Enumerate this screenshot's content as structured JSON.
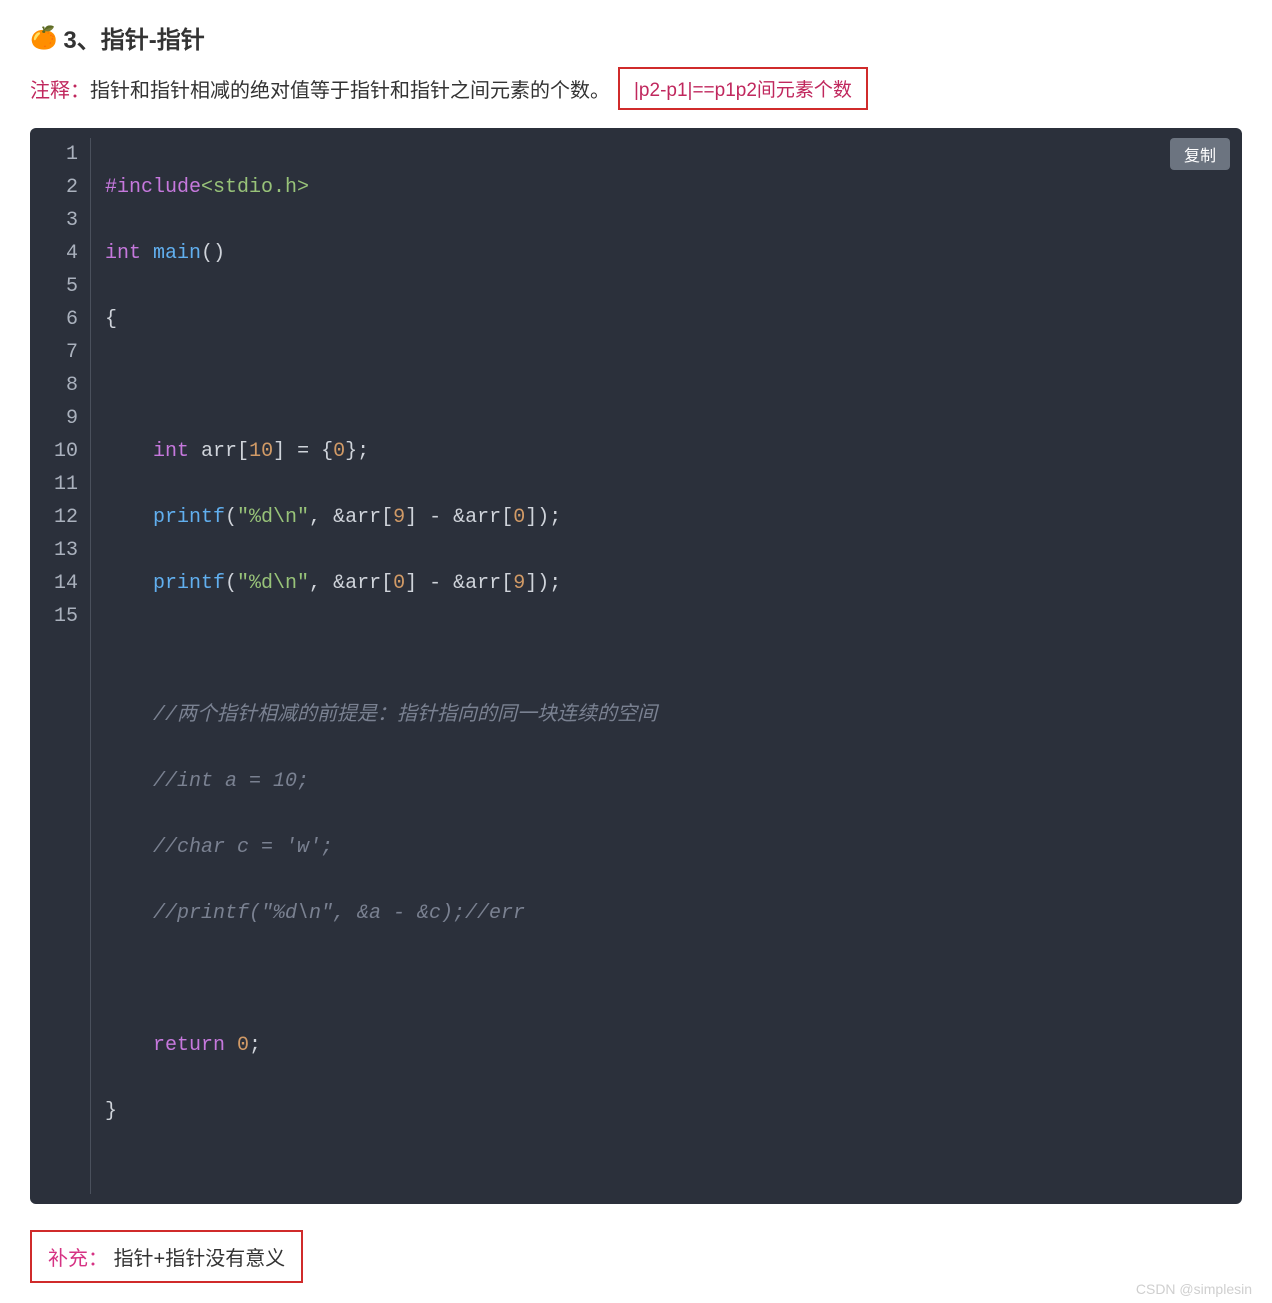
{
  "heading": {
    "emoji": "🍊",
    "text": "3、指针-指针"
  },
  "note": {
    "label": "注释：",
    "text": "指针和指针相减的绝对值等于指针和指针之间元素的个数。",
    "formula": "|p2-p1|==p1p2间元素个数"
  },
  "code": {
    "copy_label": "复制",
    "line_count": 15,
    "include_kw": "#include",
    "include_hdr": "<stdio.h>",
    "int_kw": "int",
    "main_fn": "main",
    "lparen": "(",
    "rparen": ")",
    "lbrace": "{",
    "rbrace": "}",
    "arr_ident": "arr",
    "lbrack": "[",
    "rbrack": "]",
    "ten": "10",
    "nine": "9",
    "zero": "0",
    "zeroA": "0",
    "zeroB": "0",
    "eq": " = ",
    "init": "{0}",
    "semi": ";",
    "printf_fn": "printf",
    "fmt": "\"%d\\n\"",
    "comma_sp": ", ",
    "amp": "&",
    "space_minus": " - ",
    "return_kw": "return",
    "cmt1": "//两个指针相减的前提是：指针指向的同一块连续的空间",
    "cmt2": "//int a = 10;",
    "cmt3": "//char c = 'w';",
    "cmt4": "//printf(\"%d\\n\", &a - &c);//err"
  },
  "supplement": {
    "label": "补充：",
    "text": "指针+指针没有意义"
  },
  "watermark": "CSDN @simplesin"
}
